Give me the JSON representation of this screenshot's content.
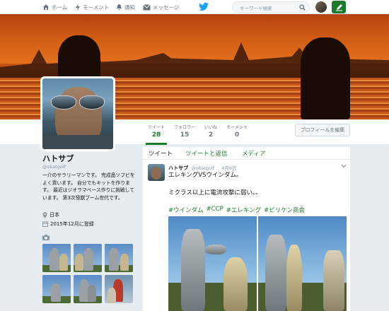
{
  "nav": {
    "home": "ホーム",
    "moments": "モーメント",
    "notifications": "通知",
    "messages": "メッセージ",
    "search_placeholder": "キーワード検索"
  },
  "profile": {
    "name": "ハトサブ",
    "handle": "@okatgolf",
    "bio": "一介のサラリーマンです。 完成品ソフビをよく買います。 自分でもキットを作ります。 最近はジオラマベース作りに挑戦しています。 第3次怪獣ブーム世代です。",
    "location": "日本",
    "joined": "2015年12月に登録"
  },
  "stats": [
    {
      "label": "ツイート",
      "value": "28"
    },
    {
      "label": "フォロワー",
      "value": "15"
    },
    {
      "label": "いいね",
      "value": "2"
    },
    {
      "label": "モーメント",
      "value": "0"
    }
  ],
  "edit_profile": "プロフィールを編集",
  "tabs": {
    "tweets": "ツイート",
    "tweets_replies": "ツイートと返信",
    "media": "メディア"
  },
  "tweet": {
    "name": "ハトサブ",
    "handle": "@okatgolf",
    "date": "4月9日",
    "line1": "エレキングVSウインダム。",
    "line2": "ミクラス以上に電流攻撃に弱い。。",
    "hashtags": [
      "#ウインダム",
      "#CCP",
      "#エレキング",
      "#ビリケン商会"
    ]
  },
  "colors": {
    "accent": "#1c7a2c",
    "link": "#1c7a2c",
    "twitter_blue": "#1da1f2"
  }
}
